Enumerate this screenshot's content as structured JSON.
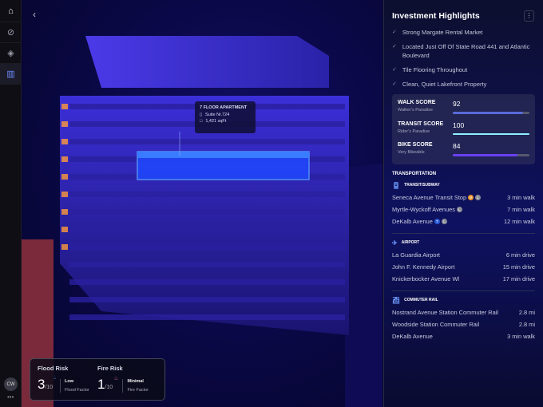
{
  "sidebar": {
    "avatar": "CW",
    "more": "•••",
    "items": [
      {
        "name": "logo-icon"
      },
      {
        "name": "compass-icon"
      },
      {
        "name": "layers-icon"
      },
      {
        "name": "map-icon"
      }
    ]
  },
  "scene": {
    "tooltip": {
      "title": "7 FLOOR APARTMENT",
      "suite": "Suite Nr.724",
      "area": "1,421 sqFt"
    }
  },
  "risk": {
    "flood": {
      "title": "Flood Risk",
      "score": "3",
      "max": "/10",
      "level": "Low",
      "label": "Flood Factor",
      "color": "#5b8fd8"
    },
    "fire": {
      "title": "Fire Risk",
      "score": "1",
      "max": "/10",
      "level": "Minimal",
      "label": "Fire Factor",
      "color": "#c45a8c"
    }
  },
  "panel": {
    "title": "Investment Highlights",
    "more": "⋮",
    "highlights": [
      "Strong Margate Rental Market",
      "Located Just Off Of State Road 441 and Atlantic Boulevard",
      "Tile Flooring Throughout",
      "Clean, Quiet Lakefront Property"
    ],
    "scores": [
      {
        "name": "WALK SCORE",
        "desc": "Walker's Paradise",
        "value": "92",
        "pct": 92,
        "color": "#5a6bd8"
      },
      {
        "name": "TRANSIT SCORE",
        "desc": "Rider's Paradise",
        "value": "100",
        "pct": 100,
        "color": "#8ff0ff"
      },
      {
        "name": "BIKE SCORE",
        "desc": "Very Bikeable",
        "value": "84",
        "pct": 84,
        "color": "#6b3ff0"
      }
    ],
    "transport_title": "TRANSPORTATION",
    "transit": {
      "title": "TRANSIT/SUBWAY",
      "rows": [
        {
          "name": "Seneca Avenue Transit Stop",
          "badges": [
            "M",
            "L"
          ],
          "time": "3 min walk"
        },
        {
          "name": "Myrtle-Wyckoff Avenues",
          "badges": [
            "L"
          ],
          "time": "7 min walk"
        },
        {
          "name": "DeKalb Avenue",
          "badges": [
            "T",
            "L"
          ],
          "time": "12 min walk"
        }
      ]
    },
    "airport": {
      "title": "AIRPORT",
      "rows": [
        {
          "name": "La Guardia Airport",
          "time": "6 min drive"
        },
        {
          "name": "John F. Kennedy Airport",
          "time": "15 min drive"
        },
        {
          "name": "Knickerbocker Avenue Wl",
          "time": "17 min drive"
        }
      ]
    },
    "rail": {
      "title": "COMMUTER RAIL",
      "rows": [
        {
          "name": "Nostrand Avenue Station Commuter Rail",
          "time": "2.8 mi"
        },
        {
          "name": "Woodside Station Commuter Rail",
          "time": "2.8 mi"
        },
        {
          "name": "DeKalb Avenue",
          "time": "3 min walk"
        }
      ]
    }
  }
}
